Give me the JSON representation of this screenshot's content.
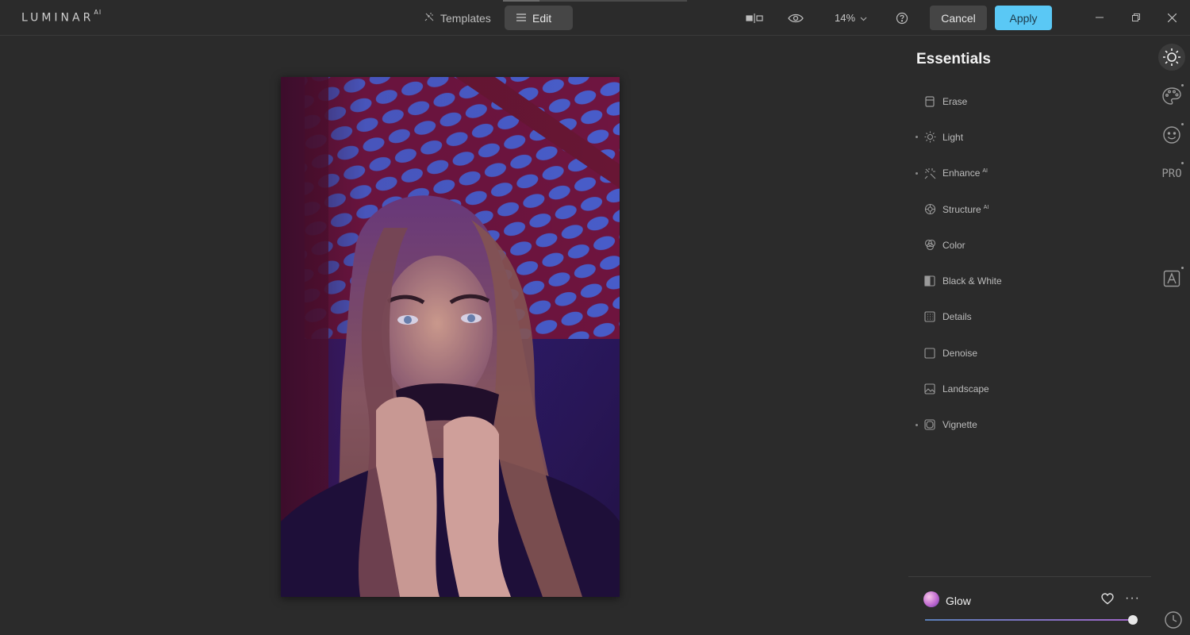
{
  "app": {
    "logo_main": "LUMINAR",
    "logo_sup": "AI"
  },
  "toolbar": {
    "templates_label": "Templates",
    "edit_label": "Edit",
    "compare_icon": "compare-split-icon",
    "preview_icon": "eye-icon",
    "zoom_value": "14%",
    "help_icon": "help-icon",
    "cancel_label": "Cancel",
    "apply_label": "Apply",
    "apply_color": "#5ac8f5"
  },
  "window_controls": {
    "minimize": "minimize-icon",
    "restore": "restore-icon",
    "close": "close-icon"
  },
  "panel": {
    "title": "Essentials",
    "tools": [
      {
        "label": "Erase",
        "icon": "eraser-icon",
        "ai": "",
        "has_dot": false
      },
      {
        "label": "Light",
        "icon": "sun-icon",
        "ai": "",
        "has_dot": true
      },
      {
        "label": "Enhance",
        "icon": "sparkle-icon",
        "ai": "AI",
        "has_dot": true
      },
      {
        "label": "Structure",
        "icon": "structure-icon",
        "ai": "AI",
        "has_dot": false
      },
      {
        "label": "Color",
        "icon": "color-circles-icon",
        "ai": "",
        "has_dot": false
      },
      {
        "label": "Black & White",
        "icon": "bw-square-icon",
        "ai": "",
        "has_dot": false
      },
      {
        "label": "Details",
        "icon": "details-icon",
        "ai": "",
        "has_dot": false
      },
      {
        "label": "Denoise",
        "icon": "denoise-icon",
        "ai": "",
        "has_dot": false
      },
      {
        "label": "Landscape",
        "icon": "landscape-icon",
        "ai": "",
        "has_dot": false
      },
      {
        "label": "Vignette",
        "icon": "vignette-icon",
        "ai": "",
        "has_dot": true
      }
    ]
  },
  "rail": {
    "essentials_icon": "sun-icon",
    "creative_icon": "palette-icon",
    "portrait_icon": "smiley-icon",
    "pro_label": "PRO",
    "local_icon": "local-masking-icon"
  },
  "glow": {
    "label": "Glow",
    "slider_value": 1.0,
    "favorite_icon": "heart-icon",
    "more_label": "···"
  },
  "history_icon": "history-clock-icon"
}
